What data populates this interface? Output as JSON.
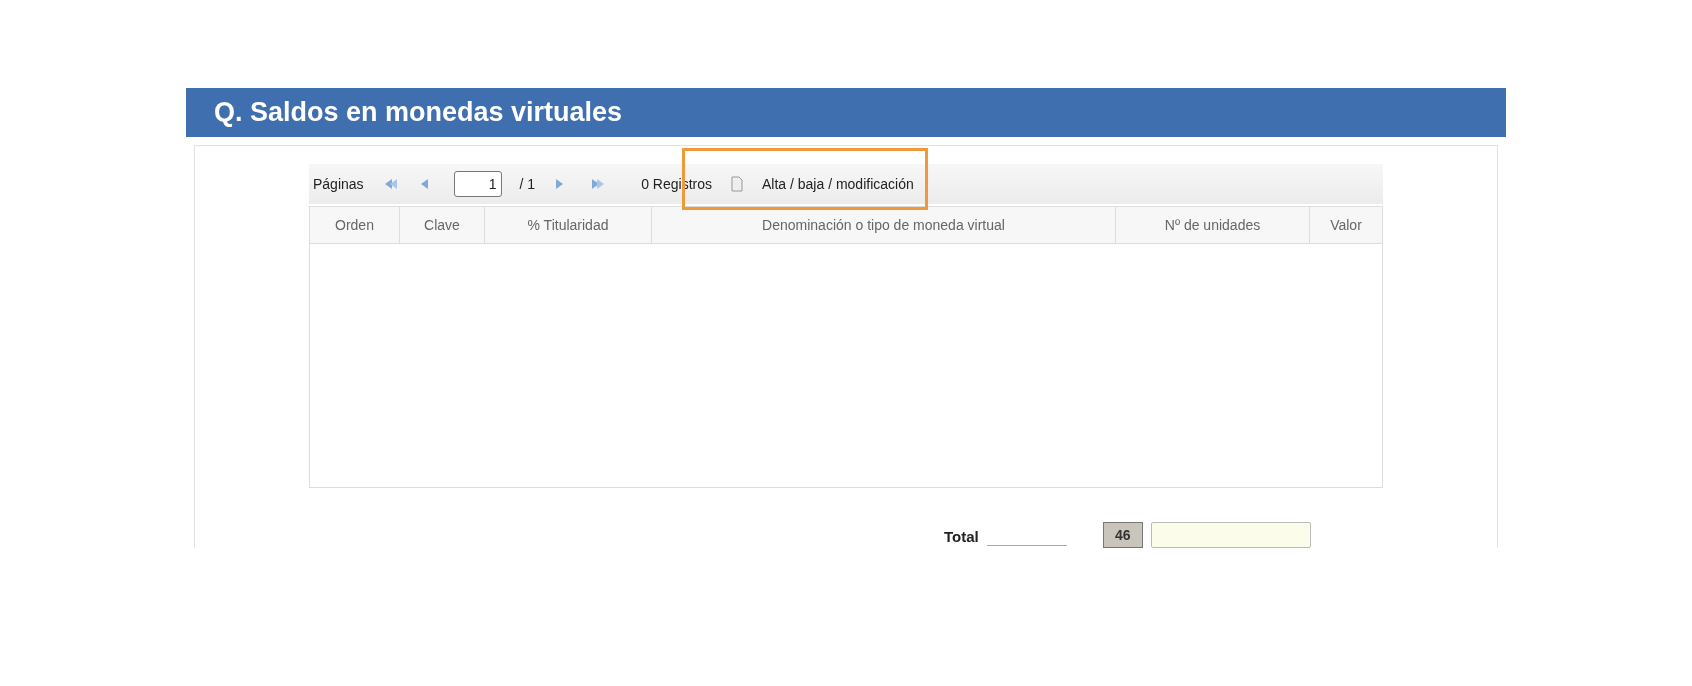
{
  "section": {
    "title": "Q. Saldos en monedas virtuales"
  },
  "pager": {
    "label": "Páginas",
    "page": "1",
    "total": "/ 1",
    "records": "0 Registros",
    "action": "Alta / baja / modificación",
    "highlighted": true
  },
  "table": {
    "columns": [
      "Orden",
      "Clave",
      "% Titularidad",
      "Denominación o tipo de moneda virtual",
      "Nº de unidades",
      "Valor"
    ]
  },
  "total": {
    "label": "Total",
    "code": "46"
  }
}
